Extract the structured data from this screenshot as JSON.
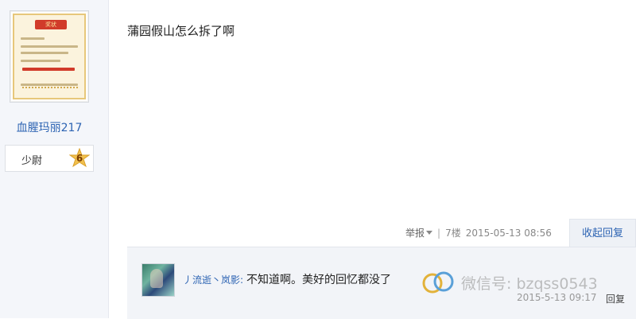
{
  "user": {
    "name": "血腥玛丽217",
    "rank_label": "少尉",
    "rank_level": "6",
    "avatar_icon": "certificate-image",
    "avatar_banner": "奖状"
  },
  "post": {
    "content": "蒲园假山怎么拆了啊",
    "report_label": "举报",
    "floor": "7楼",
    "timestamp": "2015-05-13 08:56",
    "collapse_reply_label": "收起回复"
  },
  "reply": {
    "username": "丿流逝丶岚影:",
    "text": "不知道啊。美好的回忆都没了",
    "timestamp": "2015-5-13 09:17",
    "reply_label": "回复"
  },
  "watermark": {
    "text": "微信号: bzqss0543"
  },
  "colors": {
    "link_blue": "#2d64b3",
    "meta_gray": "#888888",
    "sidebar_bg": "#f4f6fa",
    "reply_bg": "#f2f4f8"
  }
}
